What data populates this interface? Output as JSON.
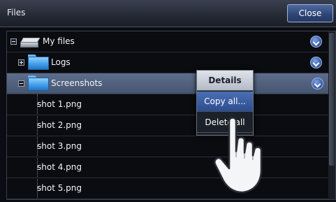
{
  "window": {
    "title": "Files",
    "close_label": "Close"
  },
  "tree": {
    "root_label": "My files",
    "logs_label": "Logs",
    "screenshots_label": "Screenshots",
    "files": [
      "shot 1.png",
      "shot 2.png",
      "shot 3.png",
      "shot 4.png",
      "shot 5.png"
    ]
  },
  "context_menu": {
    "header": "Details",
    "items": [
      "Copy all...",
      "Delete all"
    ],
    "active_item": "Copy all..."
  },
  "icons": {
    "drive": "drive-icon",
    "folder": "folder-icon",
    "info": "chevron-down-circle-icon",
    "hand": "pointing-hand-icon"
  },
  "colors": {
    "selection": "#4f5f7d",
    "accent": "#3e63b0",
    "folder": "#3e9be6"
  }
}
